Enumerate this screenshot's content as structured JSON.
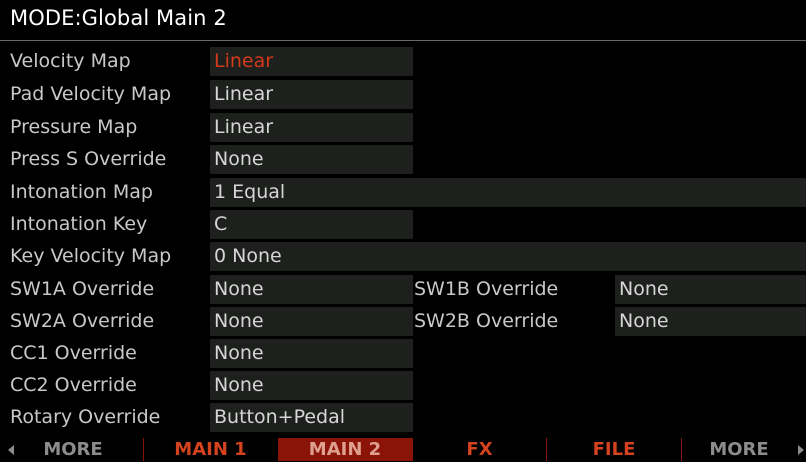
{
  "title": "MODE:Global Main 2",
  "rows": [
    {
      "label": "Velocity Map",
      "value": "Linear"
    },
    {
      "label": "Pad Velocity Map",
      "value": "Linear"
    },
    {
      "label": "Pressure Map",
      "value": "Linear"
    },
    {
      "label": "Press S Override",
      "value": "None"
    },
    {
      "label": "Intonation Map",
      "value": "1 Equal"
    },
    {
      "label": "Intonation Key",
      "value": "C"
    },
    {
      "label": "Key Velocity Map",
      "value": "0 None"
    },
    {
      "label": "SW1A Override",
      "value": "None"
    },
    {
      "label": "SW2A Override",
      "value": "None"
    },
    {
      "label": "CC1 Override",
      "value": "None"
    },
    {
      "label": "CC2 Override",
      "value": "None"
    },
    {
      "label": "Rotary Override",
      "value": "Button+Pedal"
    }
  ],
  "right_rows": [
    {
      "label": "SW1B Override",
      "value": "None"
    },
    {
      "label": "SW2B Override",
      "value": "None"
    }
  ],
  "tabs": {
    "more_left": "MORE",
    "main1": "MAIN 1",
    "main2": "MAIN 2",
    "fx": "FX",
    "file": "FILE",
    "more_right": "MORE"
  },
  "colors": {
    "background": "#000000",
    "field_bg": "#1d201d",
    "selected_value": "#d43a1a",
    "tab_text": "#d4421e",
    "active_tab_bg": "#8a1408",
    "label_text": "#c8c8c8"
  },
  "icons": {
    "left_arrow": "left-arrow-icon",
    "right_arrow": "right-arrow-icon"
  }
}
